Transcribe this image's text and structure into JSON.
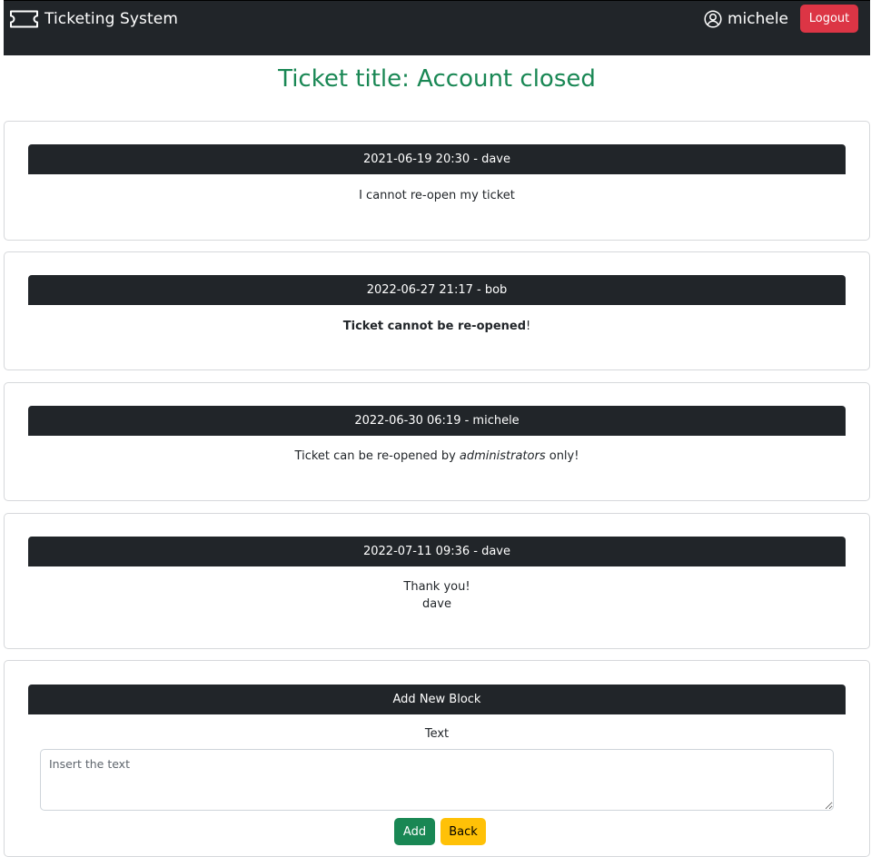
{
  "navbar": {
    "brand": "Ticketing System",
    "brand_icon": "ticket-icon",
    "user_icon": "person-circle-icon",
    "username": "michele",
    "logout_label": "Logout",
    "logout_color": "#dc3545",
    "background": "#212529"
  },
  "page": {
    "title": "Ticket title: Account closed",
    "title_color": "#198754"
  },
  "blocks": [
    {
      "header": "2021-06-19 20:30 - dave",
      "text": "I cannot re-open my ticket"
    },
    {
      "header": "2022-06-27 21:17 - bob",
      "text_bold": "Ticket cannot be re-opened",
      "text_after": "!"
    },
    {
      "header": "2022-06-30 06:19 - michele",
      "text_before": "Ticket can be re-opened by ",
      "text_italic": "administrators",
      "text_after": " only!"
    },
    {
      "header": "2022-07-11 09:36 - dave",
      "lines": [
        "Thank you!",
        "dave"
      ]
    }
  ],
  "new_block": {
    "header": "Add New Block",
    "label": "Text",
    "placeholder": "Insert the text",
    "add_label": "Add",
    "add_color": "#198754",
    "back_label": "Back",
    "back_color": "#ffc107"
  }
}
